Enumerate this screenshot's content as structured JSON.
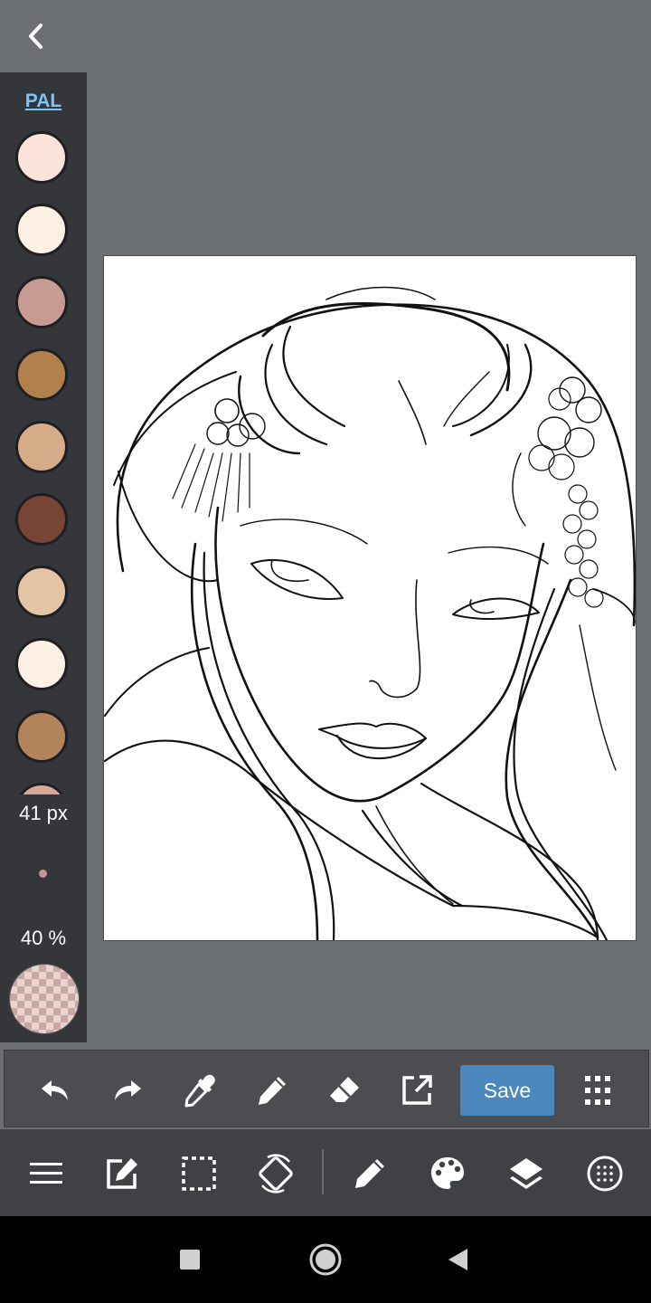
{
  "top": {
    "back_icon": "chevron-left-icon"
  },
  "palette": {
    "label": "PAL",
    "swatches": [
      "#fde3da",
      "#fdf1e4",
      "#c89b92",
      "#b2804c",
      "#d5ab88",
      "#784433",
      "#e4c4a4",
      "#fdf1e6",
      "#b3845c",
      "#d9a797"
    ],
    "brush_size": "41 px",
    "brush_color": "#c99490",
    "opacity": "40 %"
  },
  "toolbar_top": {
    "icons": [
      "undo-icon",
      "redo-icon",
      "eyedropper-icon",
      "pencil-icon",
      "eraser-icon",
      "export-icon"
    ],
    "save_label": "Save",
    "menu_icon": "grid-menu-icon"
  },
  "toolbar_bottom": {
    "icons": [
      "hamburger-menu-icon",
      "edit-icon",
      "selection-icon",
      "rotate-icon",
      "brush-icon",
      "palette-icon",
      "layers-icon",
      "grid-dots-icon"
    ]
  },
  "nav": {
    "icons": [
      "recent-apps-icon",
      "home-icon",
      "back-icon"
    ]
  },
  "colors": {
    "accent": "#4a88bd",
    "link": "#7cc4f5",
    "background": "#6b6e73"
  }
}
